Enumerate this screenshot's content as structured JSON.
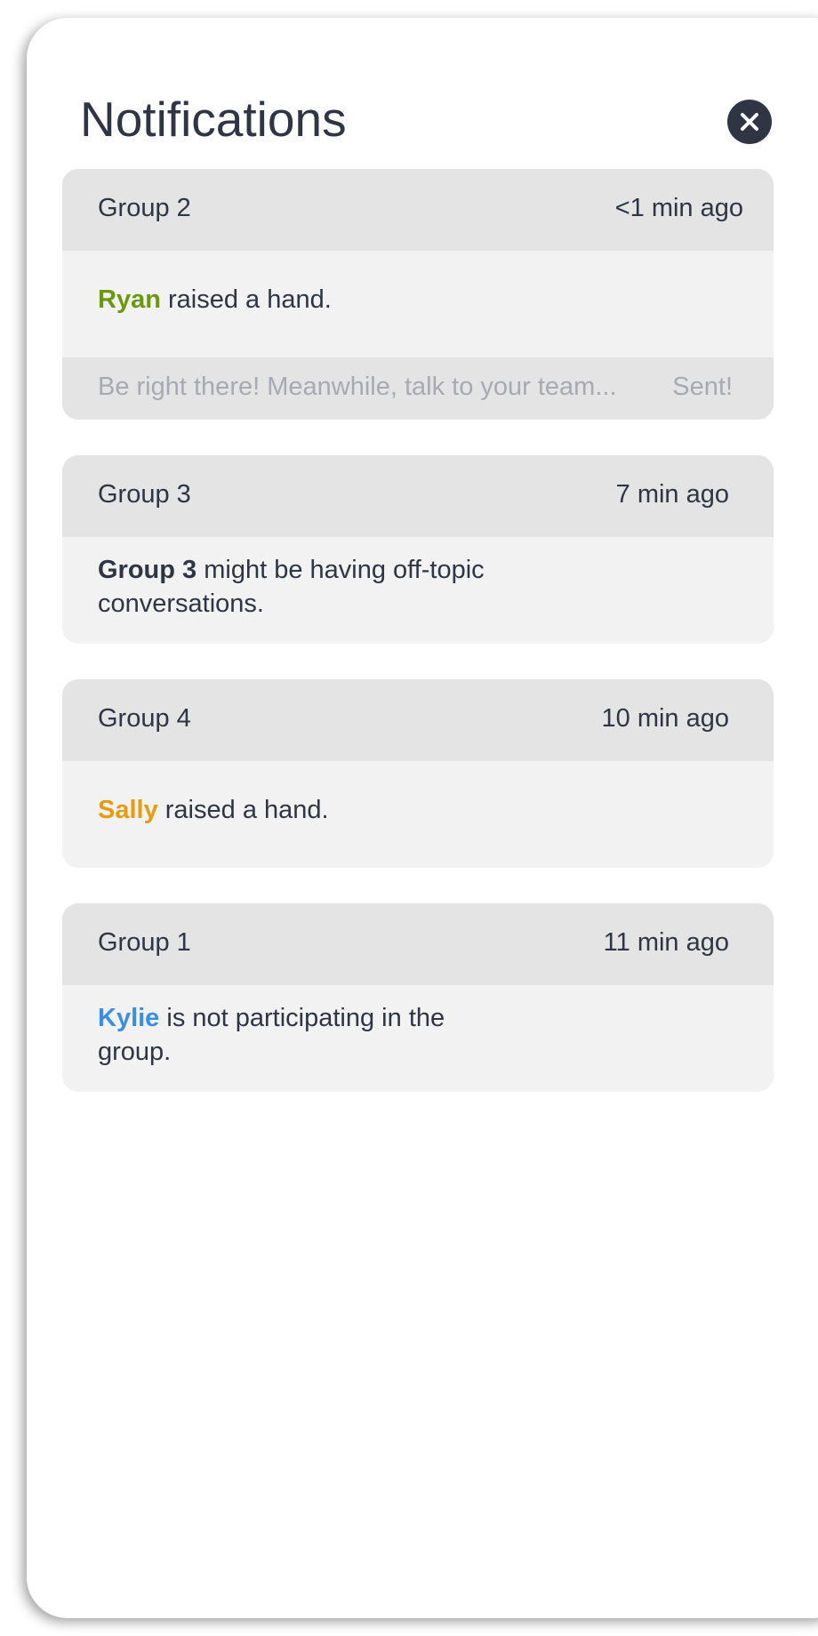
{
  "header": {
    "title": "Notifications",
    "close_icon": "close-icon"
  },
  "colors": {
    "ryan": "#6a9a0c",
    "sally": "#e89b0c",
    "kylie": "#3a8ee6",
    "dark": "#2f3542",
    "muted": "#a7aab0"
  },
  "notifications": [
    {
      "group": "Group 2",
      "time": "<1 min ago",
      "name": "Ryan",
      "message": " raised a hand.",
      "reply_text": "Be right there! Meanwhile,  talk to your team...",
      "reply_status": "Sent!"
    },
    {
      "group": "Group 3",
      "time": "7 min ago",
      "name": "Group 3",
      "message": " might be having off-topic conversations."
    },
    {
      "group": "Group 4",
      "time": "10 min ago",
      "name": "Sally",
      "message": " raised a hand."
    },
    {
      "group": "Group 1",
      "time": "11 min ago",
      "name": "Kylie",
      "message": " is not participating in the group."
    }
  ]
}
